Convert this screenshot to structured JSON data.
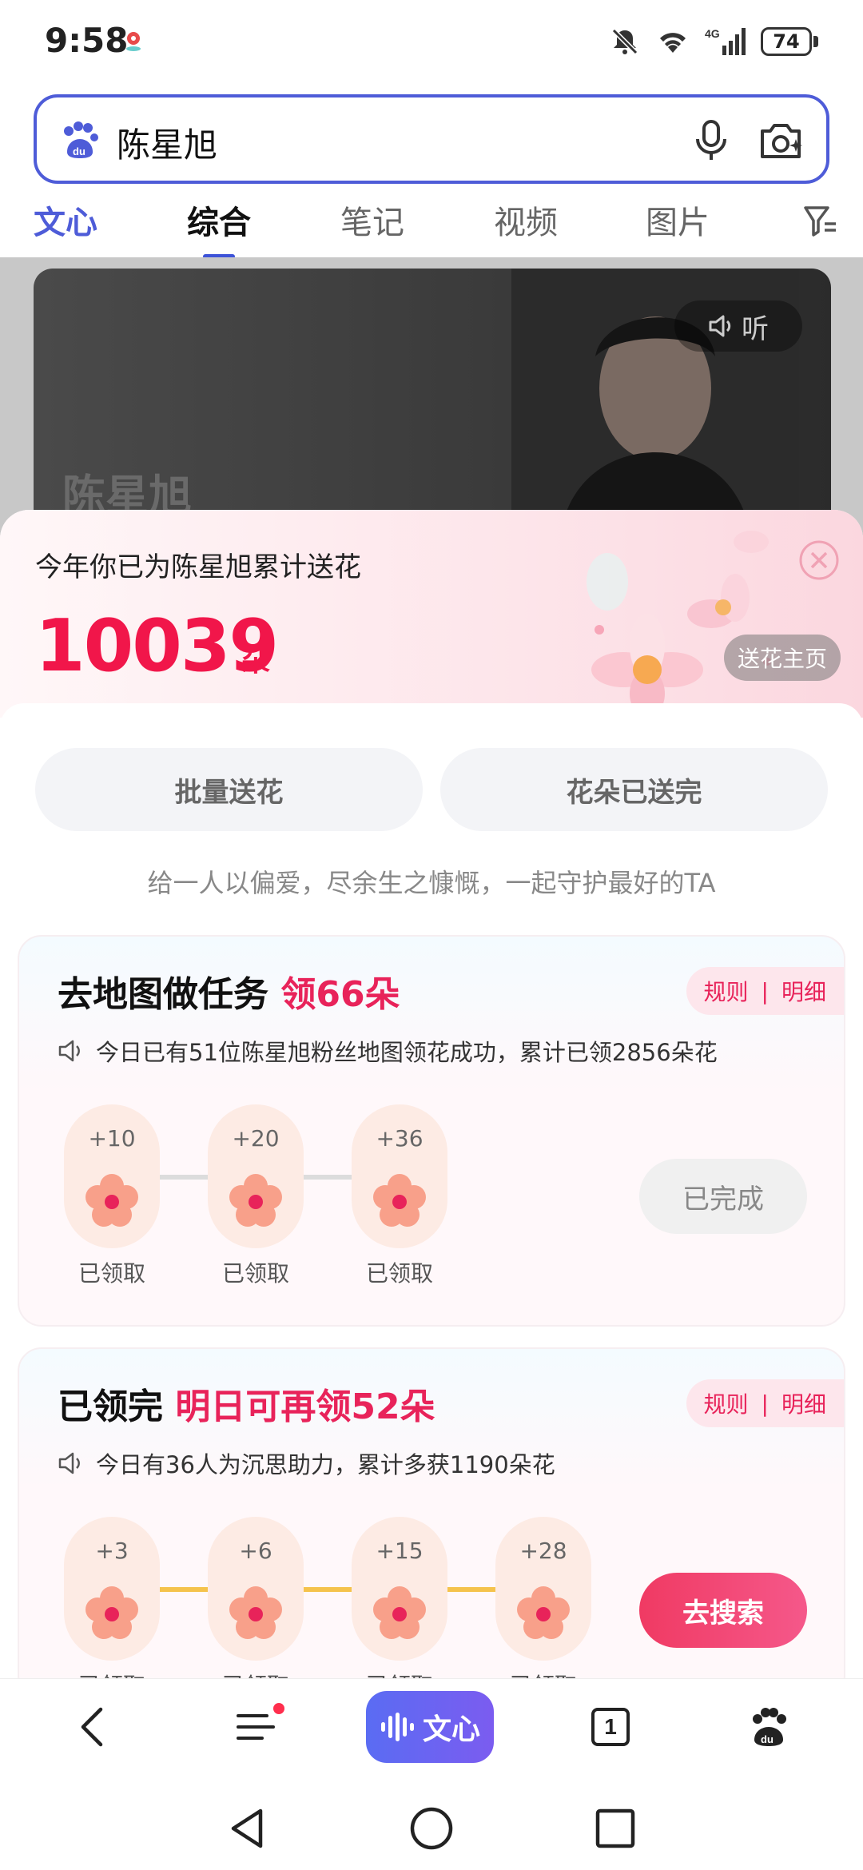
{
  "status_bar": {
    "time": "9:58",
    "battery": "74"
  },
  "search": {
    "query": "陈星旭"
  },
  "tabs": [
    {
      "label": "文心"
    },
    {
      "label": "综合"
    },
    {
      "label": "笔记"
    },
    {
      "label": "视频"
    },
    {
      "label": "图片"
    }
  ],
  "hero": {
    "name": "陈星旭",
    "listen_label": "听"
  },
  "sheet": {
    "title": "今年你已为陈星旭累计送花",
    "count": "10039",
    "unit": "朵",
    "home_button": "送花主页",
    "batch_button": "批量送花",
    "used_up_button": "花朵已送完",
    "tagline": "给一人以偏爱，尽余生之慷慨，一起守护最好的TA"
  },
  "map_task": {
    "title_prefix": "去地图做任务",
    "title_highlight": "领66朵",
    "rules": "规则",
    "separator": "|",
    "details": "明细",
    "notice": "今日已有51位陈星旭粉丝地图领花成功，累计已领2856朵花",
    "steps": [
      {
        "bonus": "+10",
        "status": "已领取"
      },
      {
        "bonus": "+20",
        "status": "已领取"
      },
      {
        "bonus": "+36",
        "status": "已领取"
      }
    ],
    "action": "已完成"
  },
  "search_task": {
    "title_prefix": "已领完",
    "title_highlight": "明日可再领52朵",
    "rules": "规则",
    "separator": "|",
    "details": "明细",
    "notice": "今日有36人为沉思助力，累计多获1190朵花",
    "steps": [
      {
        "bonus": "+3",
        "status": "已领取"
      },
      {
        "bonus": "+6",
        "status": "已领取"
      },
      {
        "bonus": "+15",
        "status": "已领取"
      },
      {
        "bonus": "+28",
        "status": "已领取"
      }
    ],
    "action": "去搜索"
  },
  "bottom_nav": {
    "wenxin_label": "文心",
    "tab_count": "1"
  },
  "colors": {
    "accent": "#4e5cd8",
    "highlight": "#e8235a",
    "count": "#f1164a"
  }
}
